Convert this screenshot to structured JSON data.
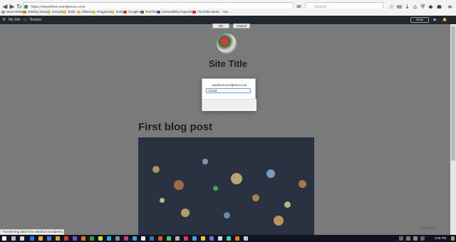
{
  "browser": {
    "url": "https://wwwfoot.wordpress.com",
    "search_placeholder": "Search"
  },
  "bookmarks": [
    {
      "label": "Most Visited"
    },
    {
      "label": "Getting Started"
    },
    {
      "label": "Security"
    },
    {
      "label": "Tools"
    },
    {
      "label": "Others"
    },
    {
      "label": "Programs"
    },
    {
      "label": "Tools"
    },
    {
      "label": "Google+"
    },
    {
      "label": "Tex/Tile"
    },
    {
      "label": "Vulnerability Reporting"
    },
    {
      "label": "YouTube Music - You..."
    }
  ],
  "wp_admin": {
    "my_site": "My Site",
    "reader": "Reader",
    "write": "Write"
  },
  "page": {
    "site_title": "Site Title",
    "post_title": "First blog post",
    "customize": "Customize"
  },
  "dialog": {
    "origin": "wwwfoot.wordpress.com",
    "input_value": "<svod",
    "ok_label": "OK",
    "cancel_label": "Cancel"
  },
  "status": {
    "text": "Transferring data from wwwfoot.wordpress.com..."
  },
  "taskbar": {
    "time": "4:08 PM"
  },
  "colors": {
    "wp_bar": "#23282d",
    "taskbar": "#101420"
  }
}
